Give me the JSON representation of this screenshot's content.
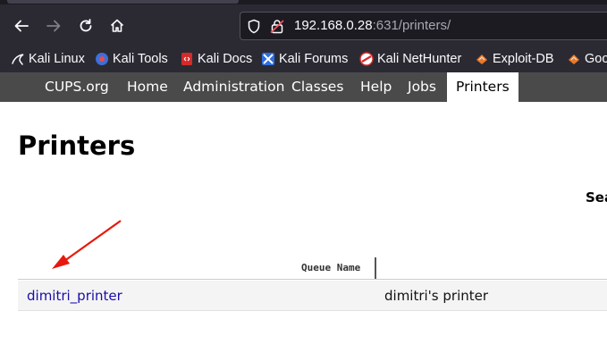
{
  "browser": {
    "url_host": "192.168.0.28",
    "url_rest": ":631/printers/",
    "bookmarks": [
      {
        "label": "Kali Linux",
        "icon": "kali-dragon-icon"
      },
      {
        "label": "Kali Tools",
        "icon": "kali-tools-icon"
      },
      {
        "label": "Kali Docs",
        "icon": "kali-docs-icon"
      },
      {
        "label": "Kali Forums",
        "icon": "kali-forums-icon"
      },
      {
        "label": "Kali NetHunter",
        "icon": "kali-nethunter-icon"
      },
      {
        "label": "Exploit-DB",
        "icon": "exploit-db-icon"
      },
      {
        "label": "Goo",
        "icon": "google-hacking-db-icon"
      }
    ]
  },
  "cups_nav": {
    "items": [
      {
        "label": "CUPS.org"
      },
      {
        "label": "Home"
      },
      {
        "label": "Administration"
      },
      {
        "label": "Classes"
      },
      {
        "label": "Help"
      },
      {
        "label": "Jobs"
      },
      {
        "label": "Printers"
      }
    ],
    "active": "Printers"
  },
  "page": {
    "title": "Printers",
    "search_label": "Sea"
  },
  "table": {
    "header_queue_name": "Queue Name",
    "rows": [
      {
        "name": "dimitri_printer",
        "description": "dimitri's printer"
      }
    ]
  },
  "colors": {
    "chrome_bg": "#2b2a33",
    "nav_bg": "#4a4a4a",
    "link": "#1a0dab",
    "annotation_arrow": "#e8190c"
  }
}
